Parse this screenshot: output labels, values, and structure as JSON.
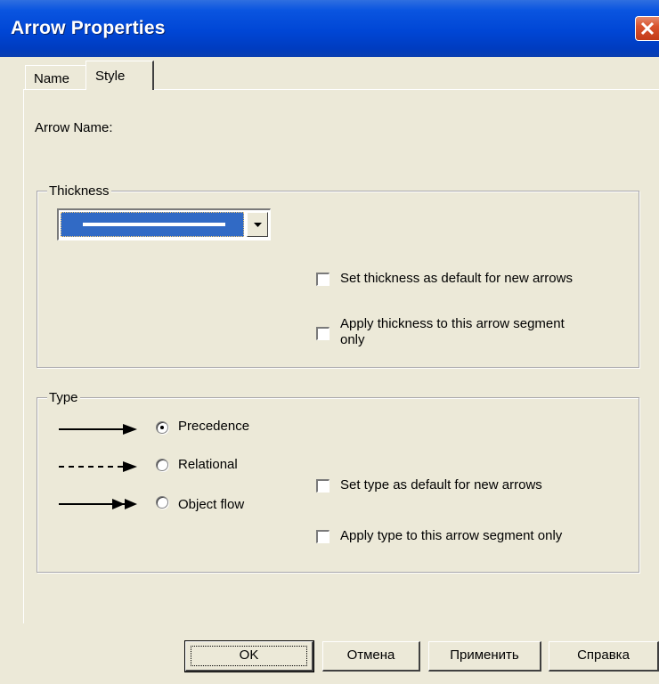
{
  "window": {
    "title": "Arrow Properties"
  },
  "tabs": [
    {
      "label": "Name",
      "active": false
    },
    {
      "label": "Style",
      "active": true
    }
  ],
  "arrow_name": {
    "label": "Arrow Name:"
  },
  "thickness": {
    "legend": "Thickness",
    "options": {
      "set_default": {
        "label": "Set thickness as default for new arrows",
        "checked": false
      },
      "apply_segment": {
        "line1": "Apply thickness to this arrow segment",
        "line2": "only",
        "checked": false
      }
    }
  },
  "type": {
    "legend": "Type",
    "radios": [
      {
        "label": "Precedence",
        "selected": true
      },
      {
        "label": "Relational",
        "selected": false
      },
      {
        "label": "Object flow",
        "selected": false
      }
    ],
    "options": {
      "set_default": {
        "label": "Set type as default for new arrows",
        "checked": false
      },
      "apply_segment": {
        "label": "Apply type to this arrow segment only",
        "checked": false
      }
    }
  },
  "buttons": {
    "ok": "OK",
    "cancel": "Отмена",
    "apply": "Применить",
    "help": "Справка"
  },
  "colors": {
    "titlebar": "#0046d5",
    "dialog_bg": "#ece9d8",
    "selection": "#316ac5",
    "close": "#d9532d"
  }
}
